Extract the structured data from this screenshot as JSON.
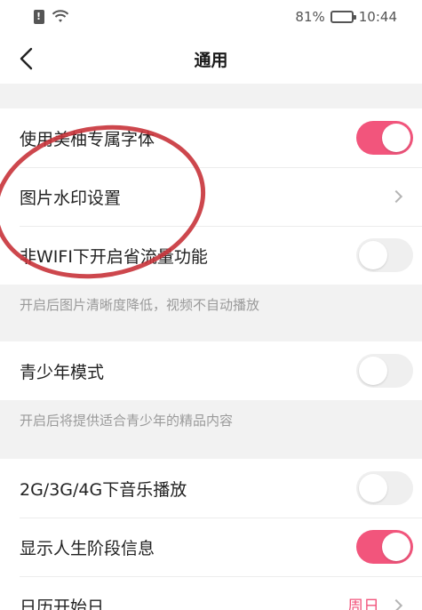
{
  "status": {
    "battery": "81%",
    "battery_level": 0.81,
    "time": "10:44"
  },
  "header": {
    "title": "通用"
  },
  "groups": [
    {
      "rows": [
        {
          "label": "使用美柚专属字体",
          "control": "toggle",
          "on": true
        },
        {
          "label": "图片水印设置",
          "control": "chevron"
        },
        {
          "label": "非WIFI下开启省流量功能",
          "control": "toggle",
          "on": false
        }
      ],
      "hint": "开启后图片清晰度降低，视频不自动播放"
    },
    {
      "rows": [
        {
          "label": "青少年模式",
          "control": "toggle",
          "on": false
        }
      ],
      "hint": "开启后将提供适合青少年的精品内容"
    },
    {
      "rows": [
        {
          "label": "2G/3G/4G下音乐播放",
          "control": "toggle",
          "on": false
        },
        {
          "label": "显示人生阶段信息",
          "control": "toggle",
          "on": true
        },
        {
          "label": "日历开始日",
          "control": "value",
          "value": "周日"
        }
      ]
    }
  ],
  "colors": {
    "accent": "#f2557c",
    "annotation": "#c8333a"
  }
}
